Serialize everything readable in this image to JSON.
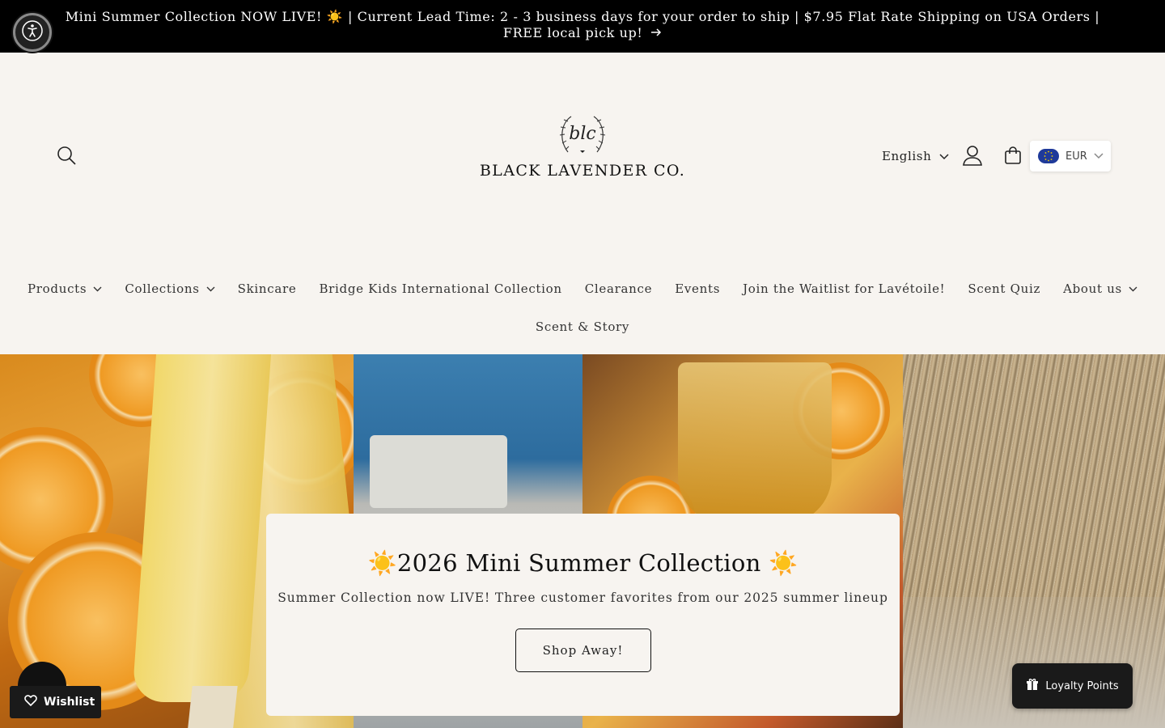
{
  "announcement": {
    "text": "Mini Summer Collection NOW LIVE! ☀️ | Current Lead Time: 2 - 3 business days for your order to ship | $7.95 Flat Rate Shipping on USA Orders | FREE local pick up!",
    "arrow": "→"
  },
  "header": {
    "logo_monogram": "blc",
    "logo_text": "BLACK LAVENDER CO.",
    "language": "English",
    "currency": "EUR"
  },
  "nav": {
    "items": [
      {
        "label": "Products",
        "dropdown": true
      },
      {
        "label": "Collections",
        "dropdown": true
      },
      {
        "label": "Skincare",
        "dropdown": false
      },
      {
        "label": "Bridge Kids International Collection",
        "dropdown": false
      },
      {
        "label": "Clearance",
        "dropdown": false
      },
      {
        "label": "Events",
        "dropdown": false
      },
      {
        "label": "Join the Waitlist for Lavétoile!",
        "dropdown": false
      },
      {
        "label": "Scent Quiz",
        "dropdown": false
      },
      {
        "label": "About us",
        "dropdown": true
      }
    ],
    "row2": [
      {
        "label": "Scent & Story",
        "dropdown": false
      }
    ]
  },
  "hero": {
    "title": "☀️2026 Mini Summer Collection ☀️",
    "subtitle": "Summer Collection now LIVE! Three customer favorites from our 2025 summer lineup",
    "button_label": "Shop Away!"
  },
  "widgets": {
    "wishlist_label": "Wishlist",
    "loyalty_label": "Loyalty Points"
  },
  "colors": {
    "announcement_bg": "#000000",
    "page_bg": "#f7f4f0",
    "widget_bg": "#1a1a1a"
  },
  "icons": [
    "accessibility-icon",
    "search-icon",
    "account-icon",
    "cart-icon",
    "chevron-down-icon",
    "eu-flag-icon",
    "arrow-right-icon",
    "heart-icon",
    "gift-icon",
    "chat-icon"
  ]
}
